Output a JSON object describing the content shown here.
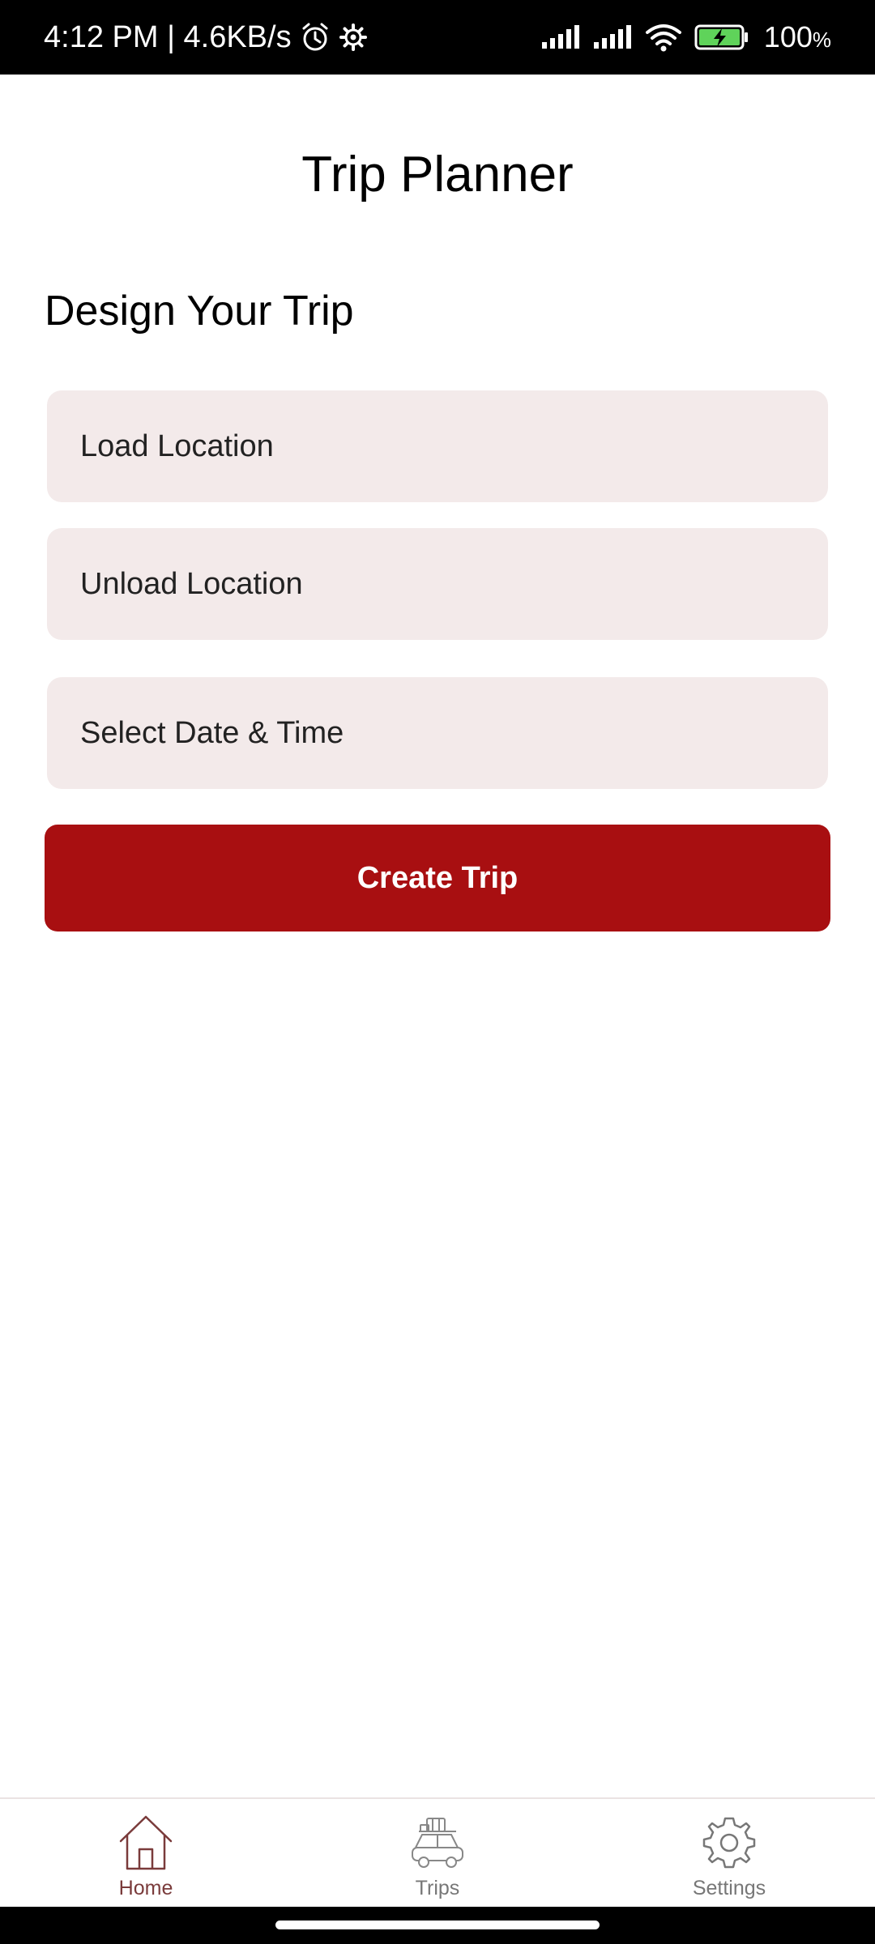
{
  "status_bar": {
    "time_speed": "4:12 PM | 4.6KB/s",
    "battery_level": "100",
    "battery_unit": "%",
    "icons": [
      "alarm-icon",
      "gear-icon",
      "signal-icon",
      "signal-icon",
      "wifi-icon",
      "battery-charging-icon"
    ]
  },
  "header": {
    "title": "Trip Planner"
  },
  "form": {
    "section_title": "Design Your Trip",
    "load_placeholder": "Load Location",
    "unload_placeholder": "Unload Location",
    "datetime_placeholder": "Select Date & Time",
    "submit_label": "Create Trip"
  },
  "bottom_nav": {
    "items": [
      {
        "label": "Home",
        "icon": "home-icon",
        "active": true
      },
      {
        "label": "Trips",
        "icon": "car-luggage-icon",
        "active": false
      },
      {
        "label": "Settings",
        "icon": "gear-icon",
        "active": false
      }
    ]
  },
  "colors": {
    "accent": "#a80f11",
    "field_background": "#f3eaea",
    "active_nav": "#7a3b3b"
  }
}
